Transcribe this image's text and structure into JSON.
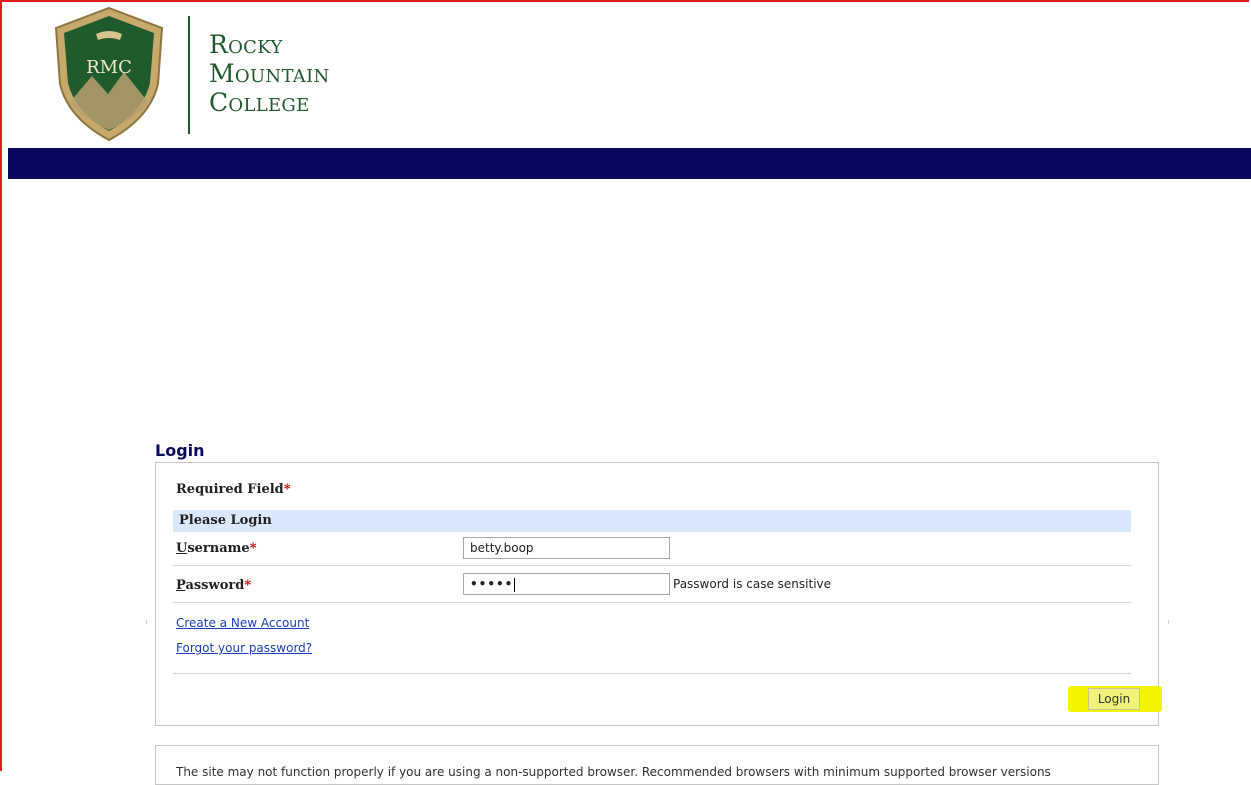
{
  "header": {
    "logo_text": "RMC",
    "college_name_lines": [
      "Rocky",
      "Mountain",
      "College"
    ]
  },
  "login": {
    "heading": "Login",
    "required_field_label": "Required Field",
    "required_marker": "*",
    "section_title": "Please Login",
    "username": {
      "label_first": "U",
      "label_rest": "sername",
      "value": "betty.boop"
    },
    "password": {
      "label_first": "P",
      "label_rest": "assword",
      "value_masked": "•••••",
      "note": "Password is case sensitive"
    },
    "links": {
      "create_account": "Create a New Account",
      "forgot_password": "Forgot your password?"
    },
    "submit_label": "Login"
  },
  "notice": {
    "text": "The site may not function properly if you are using a non-supported browser. Recommended browsers with minimum supported browser versions"
  },
  "colors": {
    "navbar": "#08095c",
    "heading": "#0a0a5c",
    "section_bar": "#d9e8fb",
    "link": "#1a3fbf",
    "required_marker": "#c00000",
    "highlight": "#f4f300",
    "frame": "#e01e1e",
    "brand_green": "#1f5b2e"
  }
}
